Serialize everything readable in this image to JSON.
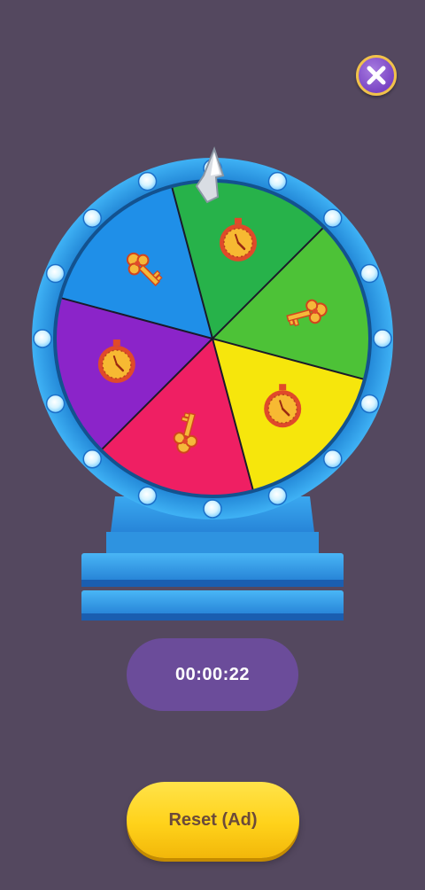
{
  "timer": {
    "text": "00:00:22"
  },
  "reset_button": {
    "label": "Reset (Ad)"
  },
  "wheel": {
    "segments": [
      {
        "color": "#27b24a",
        "icon": "stopwatch-icon"
      },
      {
        "color": "#4dc237",
        "icon": "key-icon"
      },
      {
        "color": "#f6e60c",
        "icon": "stopwatch-icon"
      },
      {
        "color": "#ef1f63",
        "icon": "key-icon"
      },
      {
        "color": "#8b24c9",
        "icon": "stopwatch-icon"
      },
      {
        "color": "#1f8fe8",
        "icon": "key-icon"
      }
    ],
    "rim_color": "#2f9ee3",
    "pointer_icon": "pointer-arrow-icon"
  },
  "close_button": {
    "icon": "close-icon"
  },
  "colors": {
    "background": "#54485f",
    "timer_pill": "#6b4c9a",
    "reset_button": "#ffd21a",
    "reset_text": "#6b4a3a"
  }
}
